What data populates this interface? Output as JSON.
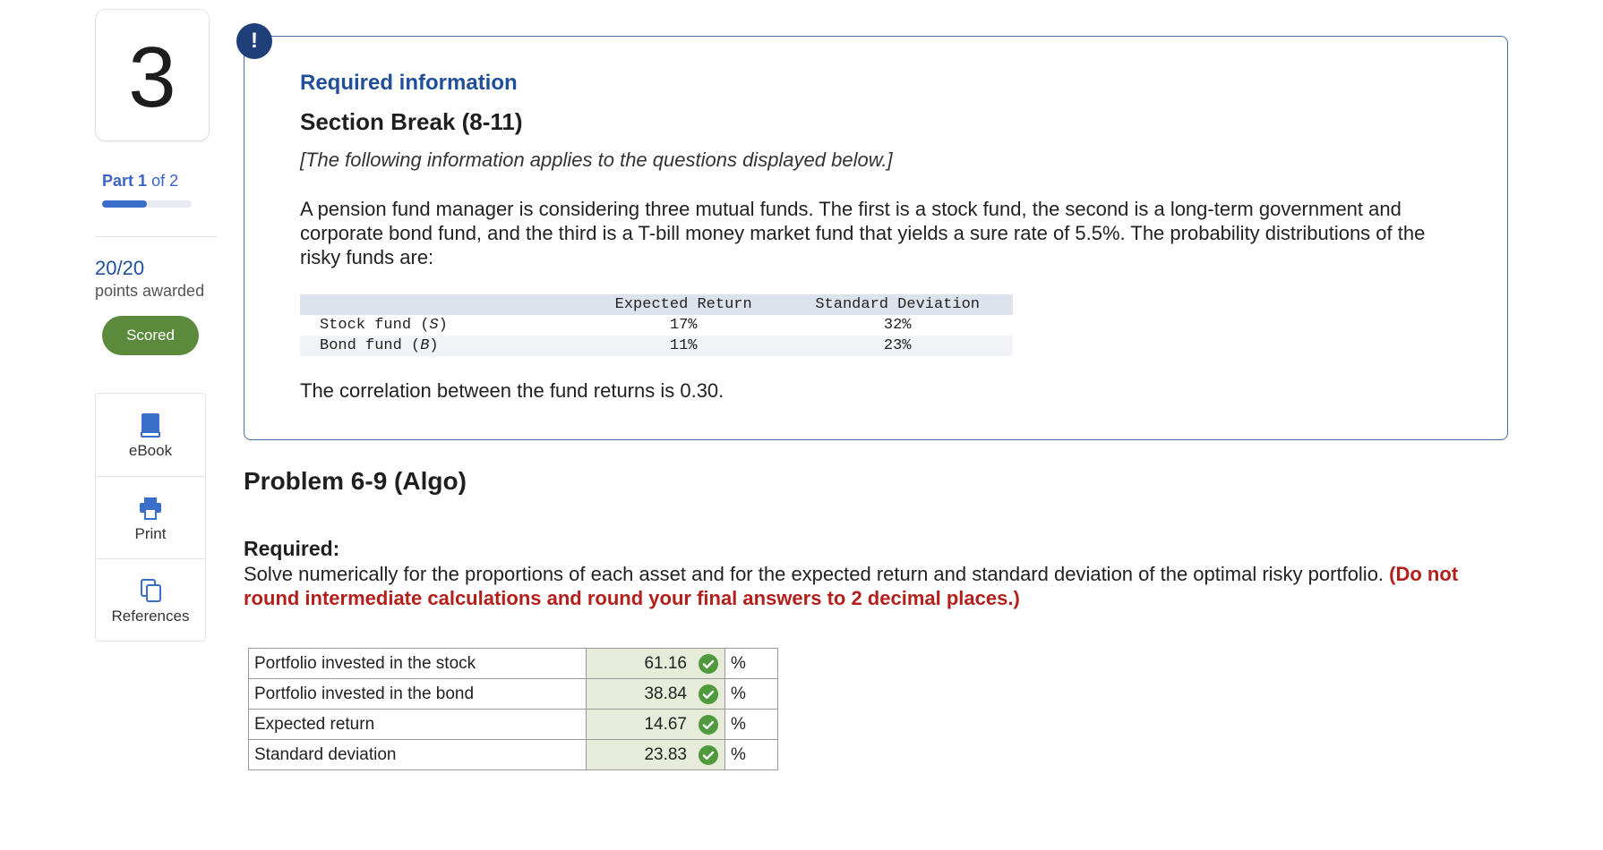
{
  "question_number": "3",
  "sidebar": {
    "part_word": "Part",
    "part_current": "1",
    "part_of": "of 2",
    "progress": 0.5,
    "score": "20/20",
    "score_label": "points awarded",
    "scored_button": "Scored",
    "tools": [
      {
        "label": "eBook",
        "icon": "book-icon"
      },
      {
        "label": "Print",
        "icon": "printer-icon"
      },
      {
        "label": "References",
        "icon": "references-icon"
      }
    ]
  },
  "info": {
    "alert_glyph": "!",
    "heading": "Required information",
    "section": "Section Break (8-11)",
    "note": "[The following information applies to the questions displayed below.]",
    "intro": "A pension fund manager is considering three mutual funds. The first is a stock fund, the second is a long-term government and corporate bond fund, and the third is a T-bill money market fund that yields a sure rate of 5.5%. The probability distributions of the risky funds are:",
    "table": {
      "headers": [
        "",
        "Expected Return",
        "Standard Deviation"
      ],
      "rows": [
        {
          "name": "Stock fund (",
          "sym": "S",
          "close": ")",
          "ret": "17%",
          "sd": "32%"
        },
        {
          "name": "Bond fund (",
          "sym": "B",
          "close": ")",
          "ret": "11%",
          "sd": "23%"
        }
      ]
    },
    "correlation": "The correlation between the fund returns is 0.30."
  },
  "problem": {
    "title": "Problem 6-9 (Algo)",
    "required_label": "Required:",
    "required_text": "Solve numerically for the proportions of each asset and for the expected return and standard deviation of the optimal risky portfolio.",
    "required_warning": "(Do not round intermediate calculations and round your final answers to 2 decimal places.)",
    "answers": [
      {
        "label": "Portfolio invested in the stock",
        "value": "61.16",
        "unit": "%"
      },
      {
        "label": "Portfolio invested in the bond",
        "value": "38.84",
        "unit": "%"
      },
      {
        "label": "Expected return",
        "value": "14.67",
        "unit": "%"
      },
      {
        "label": "Standard deviation",
        "value": "23.83",
        "unit": "%"
      }
    ]
  },
  "colors": {
    "accent": "#1f4f9a",
    "scored": "#5b8a3c",
    "warning": "#b3201c",
    "check": "#4e9a3c",
    "correct_cell": "#e6ecd9"
  }
}
